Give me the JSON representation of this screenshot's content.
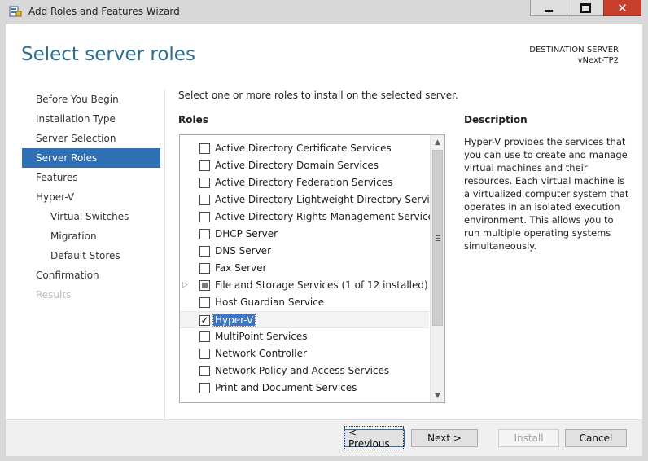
{
  "window": {
    "title": "Add Roles and Features Wizard",
    "close_glyph": "✕"
  },
  "page": {
    "title": "Select server roles",
    "destination_label": "DESTINATION SERVER",
    "destination_value": "vNext-TP2",
    "instruction": "Select one or more roles to install on the selected server."
  },
  "nav": {
    "items": [
      {
        "label": "Before You Begin"
      },
      {
        "label": "Installation Type"
      },
      {
        "label": "Server Selection"
      },
      {
        "label": "Server Roles"
      },
      {
        "label": "Features"
      },
      {
        "label": "Hyper-V"
      },
      {
        "label": "Virtual Switches"
      },
      {
        "label": "Migration"
      },
      {
        "label": "Default Stores"
      },
      {
        "label": "Confirmation"
      },
      {
        "label": "Results"
      }
    ]
  },
  "roles": {
    "heading": "Roles",
    "items": [
      {
        "label": "Active Directory Certificate Services",
        "state": "unchecked"
      },
      {
        "label": "Active Directory Domain Services",
        "state": "unchecked"
      },
      {
        "label": "Active Directory Federation Services",
        "state": "unchecked"
      },
      {
        "label": "Active Directory Lightweight Directory Services",
        "state": "unchecked"
      },
      {
        "label": "Active Directory Rights Management Services",
        "state": "unchecked"
      },
      {
        "label": "DHCP Server",
        "state": "unchecked"
      },
      {
        "label": "DNS Server",
        "state": "unchecked"
      },
      {
        "label": "Fax Server",
        "state": "unchecked"
      },
      {
        "label": "File and Storage Services (1 of 12 installed)",
        "state": "partial",
        "expander": "▷"
      },
      {
        "label": "Host Guardian Service",
        "state": "unchecked"
      },
      {
        "label": "Hyper-V",
        "state": "checked",
        "check_glyph": "✓"
      },
      {
        "label": "MultiPoint Services",
        "state": "unchecked"
      },
      {
        "label": "Network Controller",
        "state": "unchecked"
      },
      {
        "label": "Network Policy and Access Services",
        "state": "unchecked"
      },
      {
        "label": "Print and Document Services",
        "state": "unchecked"
      }
    ],
    "scroll_up": "▲",
    "scroll_down": "▼"
  },
  "description": {
    "heading": "Description",
    "text": "Hyper-V provides the services that you can use to create and manage virtual machines and their resources. Each virtual machine is a virtualized computer system that operates in an isolated execution environment. This allows you to run multiple operating systems simultaneously."
  },
  "footer": {
    "previous_label": "< Previous",
    "next_label": "Next >",
    "install_label": "Install",
    "cancel_label": "Cancel"
  },
  "colors": {
    "accent": "#2f6fb5",
    "title": "#2d6e8e",
    "close": "#c7402d"
  }
}
